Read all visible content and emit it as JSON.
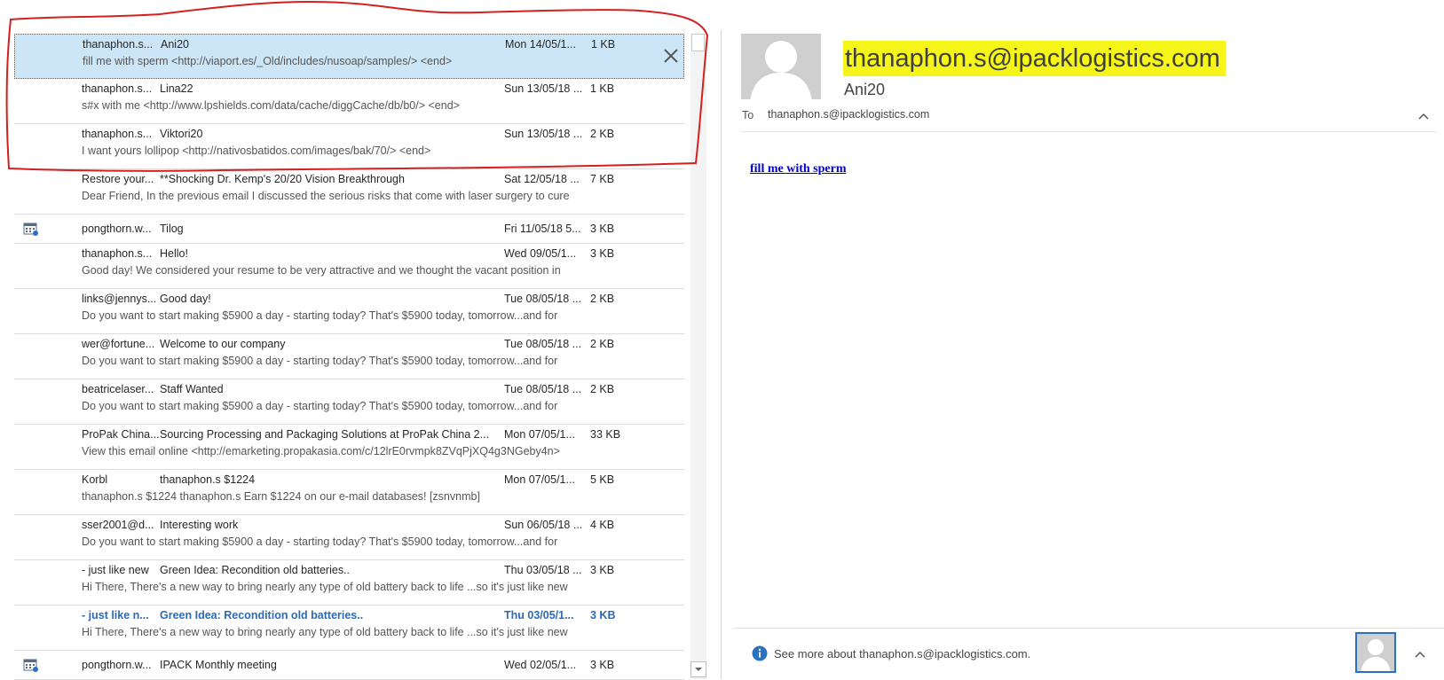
{
  "messages": [
    {
      "sender": "thanaphon.s...",
      "subject": "Ani20",
      "date": "Mon 14/05/1...",
      "size": "1 KB",
      "preview": "fill me with sperm <http://viaport.es/_Old/includes/nusoap/samples/>   <end>"
    },
    {
      "sender": "thanaphon.s...",
      "subject": "Lina22",
      "date": "Sun 13/05/18 ...",
      "size": "1 KB",
      "preview": "s#x with me <http://www.lpshields.com/data/cache/diggCache/db/b0/>   <end>"
    },
    {
      "sender": "thanaphon.s...",
      "subject": "Viktori20",
      "date": "Sun 13/05/18 ...",
      "size": "2 KB",
      "preview": "I want yours lollipop <http://nativosbatidos.com/images/bak/70/>   <end>"
    },
    {
      "sender": "Restore your...",
      "subject": "**Shocking Dr. Kemp's 20/20 Vision Breakthrough",
      "date": "Sat 12/05/18 ...",
      "size": "7 KB",
      "preview": "Dear Friend,    In the previous email I discussed the serious risks that come with laser surgery to cure"
    },
    {
      "sender": "pongthorn.w...",
      "subject": "Tilog",
      "date": "Fri 11/05/18 5...",
      "size": "3 KB",
      "preview": ""
    },
    {
      "sender": "thanaphon.s...",
      "subject": "Hello!",
      "date": "Wed 09/05/1...",
      "size": "3 KB",
      "preview": "Good day!  We considered your resume to be very attractive and we thought the vacant position in"
    },
    {
      "sender": "links@jennys...",
      "subject": "Good day!",
      "date": "Tue 08/05/18 ...",
      "size": "2 KB",
      "preview": "Do you want to start making $5900 a day - starting today?  That's $5900 today, tomorrow...and for"
    },
    {
      "sender": "wer@fortune...",
      "subject": "Welcome to our company",
      "date": "Tue 08/05/18 ...",
      "size": "2 KB",
      "preview": "Do you want to start making $5900 a day - starting today?  That's $5900 today, tomorrow...and for"
    },
    {
      "sender": "beatricelaser...",
      "subject": "Staff Wanted",
      "date": "Tue 08/05/18 ...",
      "size": "2 KB",
      "preview": "Do you want to start making $5900 a day - starting today?  That's $5900 today, tomorrow...and for"
    },
    {
      "sender": "ProPak China...",
      "subject": "Sourcing Processing and Packaging Solutions at ProPak China 2...",
      "date": "Mon 07/05/1...",
      "size": "33 KB",
      "preview": "View this email online <http://emarketing.propakasia.com/c/12lrE0rvmpk8ZVqPjXQ4g3NGeby4n>"
    },
    {
      "sender": "Korbl",
      "subject": "thanaphon.s $1224",
      "date": "Mon 07/05/1...",
      "size": "5 KB",
      "preview": "thanaphon.s $1224  thanaphon.s Earn $1224 on our e-mail databases! [zsnvnmb]"
    },
    {
      "sender": "sser2001@d...",
      "subject": "Interesting work",
      "date": "Sun 06/05/18 ...",
      "size": "4 KB",
      "preview": "Do you want to start making $5900 a day - starting today?  That's $5900 today, tomorrow...and for"
    },
    {
      "sender": "- just like new",
      "subject": "Green Idea: Recondition old batteries..",
      "date": "Thu 03/05/18 ...",
      "size": "3 KB",
      "preview": "Hi There,  There's a new way to bring nearly any type of old battery back to life ...so it's just like new"
    },
    {
      "sender": "- just like n...",
      "subject": "Green Idea: Recondition old batteries..",
      "date": "Thu 03/05/1...",
      "size": "3 KB",
      "preview": "Hi There,  There's a new way to bring nearly any type of old battery back to life ...so it's just like new"
    },
    {
      "sender": "pongthorn.w...",
      "subject": "IPACK Monthly meeting",
      "date": "Wed 02/05/1...",
      "size": "3 KB",
      "preview": ""
    }
  ],
  "reading_pane": {
    "from_email": "thanaphon.s@ipacklogistics.com",
    "from_name": "Ani20",
    "to_label": "To",
    "to_value": "thanaphon.s@ipacklogistics.com",
    "body_link_text": "fill me with sperm",
    "people_pane_text": "See more about thanaphon.s@ipacklogistics.com."
  },
  "colors": {
    "selected_row": "#cde6f7",
    "unread_text": "#2b6bb5",
    "highlight": "#f5f51a",
    "annotation": "#d42020",
    "link": "#0000cc"
  },
  "icons": [
    "close-icon",
    "calendar-icon",
    "info-icon",
    "chevron-up-icon",
    "chevron-down-icon",
    "person-icon"
  ]
}
